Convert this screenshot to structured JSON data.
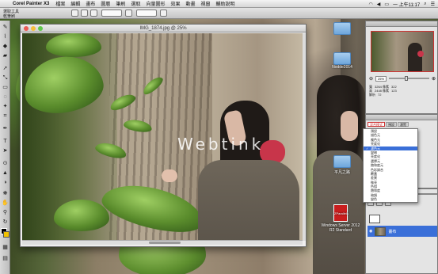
{
  "menubar": {
    "app_name": "Corel Painter X3",
    "items": [
      "檔案",
      "編輯",
      "畫布",
      "圖層",
      "筆刷",
      "選取",
      "向量圖形",
      "效果",
      "動畫",
      "視窗",
      "輔助說明"
    ],
    "clock": "一 上午11:17"
  },
  "propbar": {
    "line1": "選取工具",
    "line2": "乾筆刷"
  },
  "document": {
    "title": "IMG_1874.jpg @ 25%",
    "watermark": "Webtink"
  },
  "desktop_icons": [
    {
      "label": "",
      "type": "folder"
    },
    {
      "label": "",
      "type": "folder"
    },
    {
      "label": "Nodde2014",
      "type": "folder"
    },
    {
      "label": "平凡之路",
      "type": "folder"
    },
    {
      "label": "Windows Server 2012 R2 Standard",
      "type": "pdf",
      "badge": "ZParallels"
    }
  ],
  "navigator": {
    "zoom": "25%",
    "info_w_label": "寬",
    "info_w": "3264 像素",
    "info_h_label": "高",
    "info_h": "2448 像素",
    "info_res_label": "解析",
    "info_res": "72",
    "coords": [
      "322",
      "123"
    ]
  },
  "layer_panel": {
    "tabs": [
      "混合模式",
      "預設",
      "瀏覽"
    ],
    "blend_options": [
      "預設",
      "描色元",
      "複色元",
      "亮度化",
      "濾色元",
      "變暗",
      "亮度化",
      "選擇元",
      "飽和度元",
      "色彩調合",
      "覆蓋",
      "差異",
      "微亮",
      "色相",
      "飽和度",
      "暗調",
      "變色"
    ],
    "selected_blend": "濾色元",
    "opacity_label": "透明度",
    "layers": [
      {
        "name": "",
        "selected": false
      },
      {
        "name": "畫布",
        "selected": true
      }
    ]
  },
  "colors": {
    "selection": "#3a6fd8",
    "accent": "#c33333",
    "hood": "#c8354a"
  }
}
